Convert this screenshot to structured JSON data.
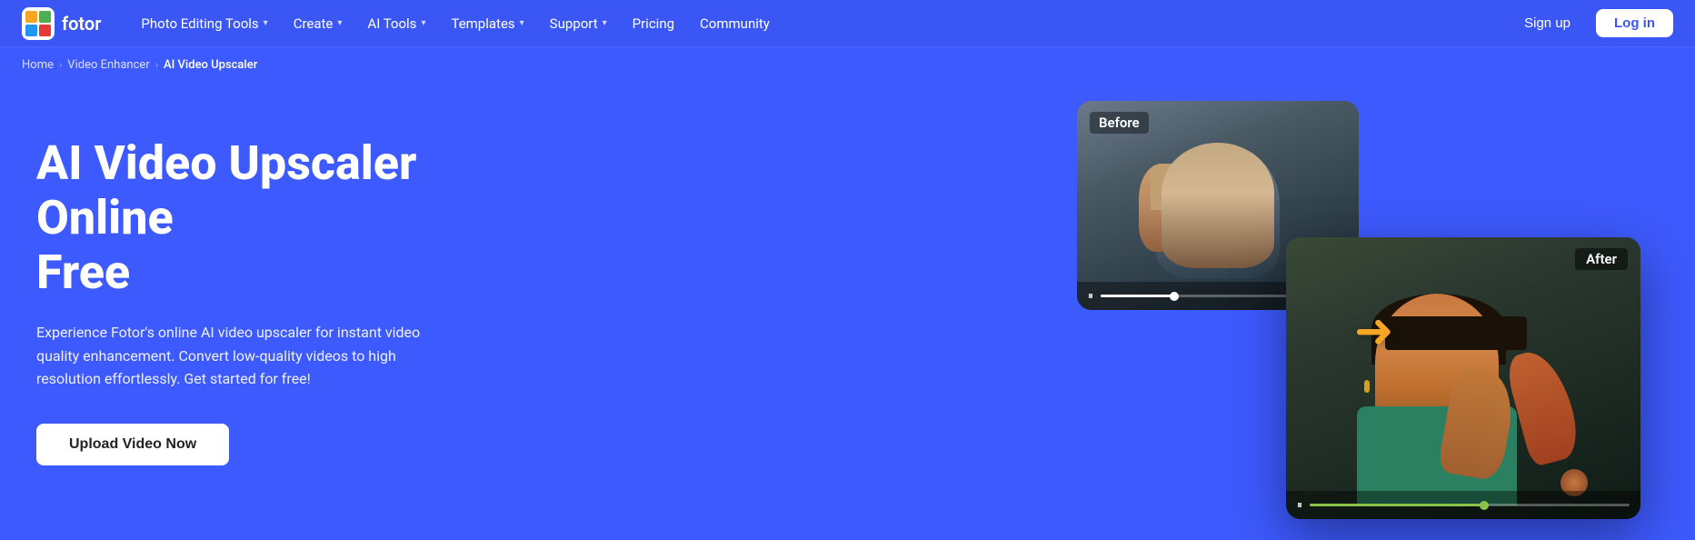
{
  "brand": {
    "name": "fotor",
    "logo_alt": "fotor logo"
  },
  "nav": {
    "items": [
      {
        "label": "Photo Editing Tools",
        "has_dropdown": true
      },
      {
        "label": "Create",
        "has_dropdown": true
      },
      {
        "label": "AI Tools",
        "has_dropdown": true
      },
      {
        "label": "Templates",
        "has_dropdown": true
      },
      {
        "label": "Support",
        "has_dropdown": true
      },
      {
        "label": "Pricing",
        "has_dropdown": false
      },
      {
        "label": "Community",
        "has_dropdown": false
      }
    ],
    "signup_label": "Sign up",
    "login_label": "Log in"
  },
  "breadcrumb": {
    "items": [
      {
        "label": "Home",
        "active": false
      },
      {
        "label": "Video Enhancer",
        "active": false
      },
      {
        "label": "AI Video Upscaler",
        "active": true
      }
    ]
  },
  "hero": {
    "title_line1": "AI Video Upscaler Online",
    "title_line2": "Free",
    "description": "Experience Fotor's online AI video upscaler for instant video quality enhancement. Convert low-quality videos to high resolution effortlessly. Get started for free!",
    "cta_label": "Upload Video Now"
  },
  "video_cards": {
    "before_label": "Before",
    "after_label": "After",
    "before_progress": 30,
    "after_progress": 55
  },
  "colors": {
    "background": "#3d5afe",
    "nav_bg": "#3a56f5",
    "cta_bg": "#ffffff",
    "arrow": "#f5a623"
  }
}
